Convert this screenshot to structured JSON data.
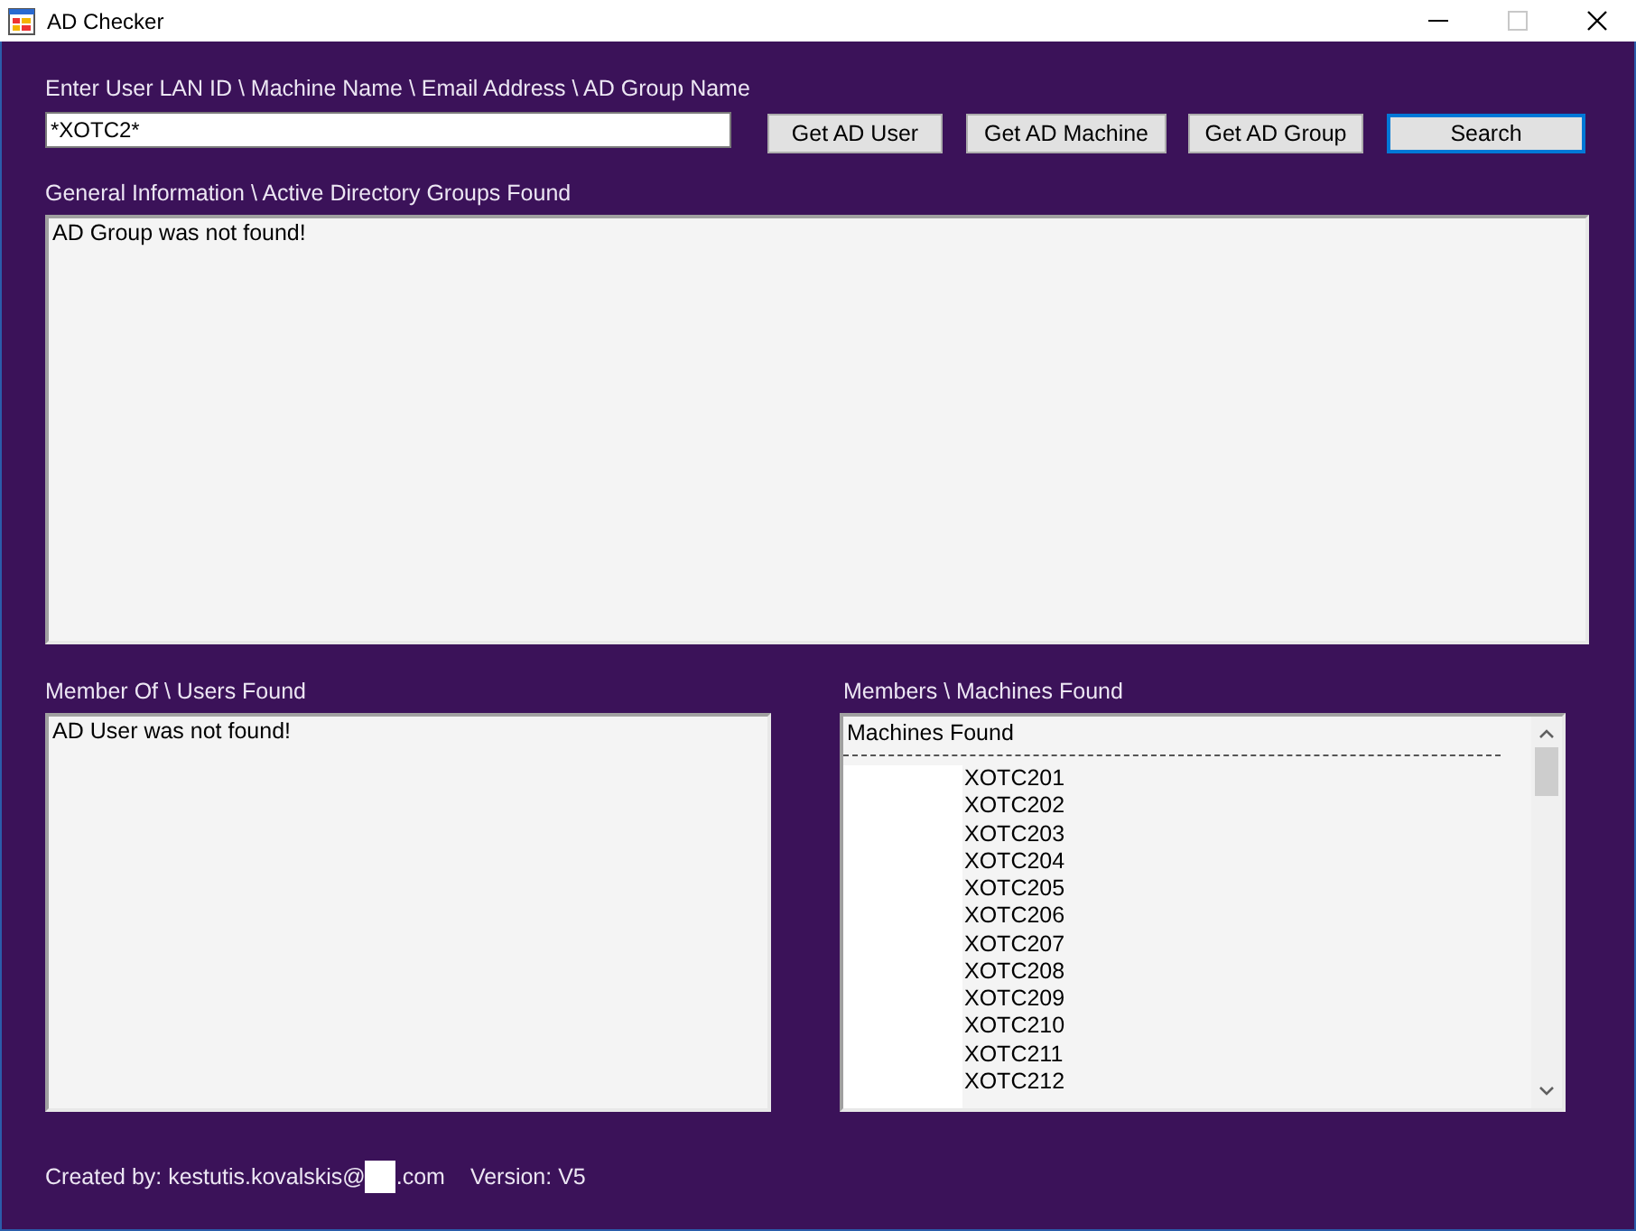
{
  "window": {
    "title": "AD Checker",
    "controls": [
      {
        "kind": "minimize",
        "disabled": false
      },
      {
        "kind": "maximize",
        "disabled": true
      },
      {
        "kind": "close",
        "disabled": false
      }
    ]
  },
  "search": {
    "label": "Enter User LAN ID \\ Machine Name \\ Email Address \\ AD Group Name",
    "value": "*XOTC2*"
  },
  "buttons": [
    {
      "label": "Get AD User",
      "focused": false
    },
    {
      "label": "Get AD Machine",
      "focused": false
    },
    {
      "label": "Get AD Group",
      "focused": false
    },
    {
      "label": "Search",
      "focused": true
    }
  ],
  "general_info": {
    "label": "General Information \\ Active Directory Groups Found",
    "text": "AD Group was not found!"
  },
  "member_of": {
    "label": "Member Of \\ Users Found",
    "text": "AD User was not found!"
  },
  "members": {
    "label": "Members \\ Machines Found",
    "heading": "Machines Found",
    "machines": [
      "XOTC201",
      "XOTC202",
      "XOTC203",
      "XOTC204",
      "XOTC205",
      "XOTC206",
      "XOTC207",
      "XOTC208",
      "XOTC209",
      "XOTC210",
      "XOTC211",
      "XOTC212"
    ]
  },
  "footer": {
    "created_by": "Created by: kestutis.kovalskis@",
    "domain_suffix": ".com",
    "version": "Version: V5"
  }
}
